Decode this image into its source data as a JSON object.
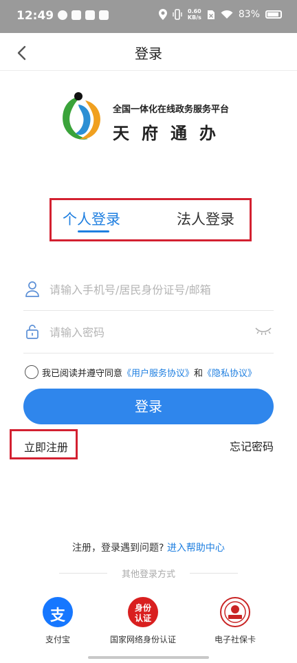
{
  "status_bar": {
    "time": "12:49",
    "net_speed_value": "0.60",
    "net_speed_unit": "KB/s",
    "battery": "83%"
  },
  "header": {
    "title": "登录"
  },
  "logo": {
    "subtitle": "全国一体化在线政务服务平台",
    "title": "天府通办"
  },
  "tabs": [
    {
      "label": "个人登录",
      "active": true
    },
    {
      "label": "法人登录",
      "active": false
    }
  ],
  "form": {
    "account_placeholder": "请输入手机号/居民身份证号/邮箱",
    "password_placeholder": "请输入密码",
    "agreement_prefix": "我已阅读并遵守同意",
    "user_agreement": "《用户服务协议》",
    "and_text": "和",
    "privacy_agreement": "《隐私协议》",
    "login_button": "登录",
    "register_link": "立即注册",
    "forgot_link": "忘记密码"
  },
  "help": {
    "prompt": "注册，登录遇到问题?",
    "link": "进入帮助中心"
  },
  "other_login": {
    "divider": "其他登录方式",
    "methods": [
      {
        "label": "支付宝",
        "icon": "alipay-icon",
        "glyph": "支"
      },
      {
        "label": "国家网络身份认证",
        "icon": "id-auth-icon",
        "glyph_top": "身份",
        "glyph_bottom": "认证"
      },
      {
        "label": "电子社保卡",
        "icon": "social-security-card-icon"
      }
    ]
  },
  "colors": {
    "accent": "#2f86ec",
    "link": "#1f7fe0",
    "highlight_box": "#d32030",
    "status_bar": "#9a9a9a"
  }
}
